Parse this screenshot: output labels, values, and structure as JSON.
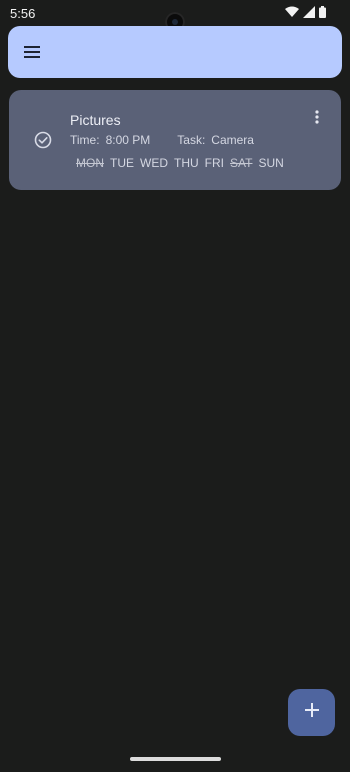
{
  "status_bar": {
    "time": "5:56",
    "icons": [
      "wifi-icon",
      "signal-icon",
      "battery-icon"
    ]
  },
  "top_bar": {
    "menu_icon": "hamburger-menu-icon",
    "color": "#b6caff"
  },
  "alarm": {
    "title": "Pictures",
    "time_label": "Time:",
    "time_value": "8:00 PM",
    "task_label": "Task:",
    "task_value": "Camera",
    "enabled": true,
    "days": [
      {
        "label": "MON",
        "active": false
      },
      {
        "label": "TUE",
        "active": true
      },
      {
        "label": "WED",
        "active": true
      },
      {
        "label": "THU",
        "active": true
      },
      {
        "label": "FRI",
        "active": true
      },
      {
        "label": "SAT",
        "active": false
      },
      {
        "label": "SUN",
        "active": true
      }
    ],
    "card_color": "#5a6177"
  },
  "fab": {
    "icon": "plus-icon",
    "color": "#4f659f"
  },
  "colors": {
    "background": "#1b1c1b"
  }
}
